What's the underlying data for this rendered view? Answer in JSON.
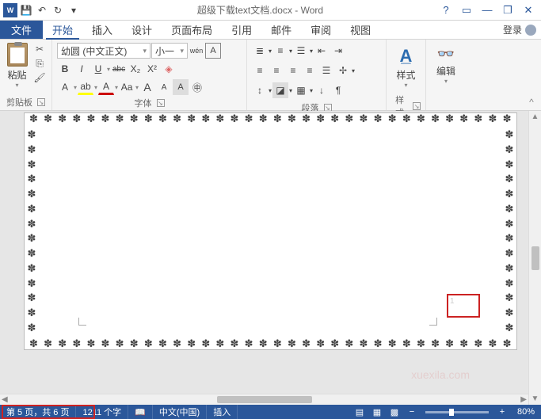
{
  "title": "超级下载text文档.docx - Word",
  "qat": {
    "save": "💾",
    "undo": "↶",
    "redo": "↻",
    "more": "▾"
  },
  "win": {
    "help": "?",
    "ribbonopts": "▭",
    "min": "—",
    "restore": "❐",
    "close": "✕"
  },
  "tabs": {
    "file": "文件",
    "home": "开始",
    "insert": "插入",
    "design": "设计",
    "layout": "页面布局",
    "references": "引用",
    "mailings": "邮件",
    "review": "审阅",
    "view": "视图",
    "signin": "登录"
  },
  "clipboard": {
    "paste": "粘贴",
    "group": "剪贴板"
  },
  "font": {
    "name": "幼圆 (中文正文)",
    "size": "小一",
    "wen": "wén",
    "Abox": "A",
    "group": "字体",
    "bold": "B",
    "italic": "I",
    "underline": "U",
    "strike": "abc",
    "sub": "X₂",
    "sup": "X²",
    "effects": "A",
    "highlight": "▁",
    "fontcolor": "A",
    "char": "Aa",
    "grow": "A",
    "shrink": "A",
    "change": "A",
    "clear": "◇"
  },
  "paragraph": {
    "group": "段落"
  },
  "styles": {
    "label": "样式",
    "group": "样式"
  },
  "editing": {
    "label": "编辑",
    "group": ""
  },
  "page": {
    "number": "1"
  },
  "status": {
    "page": "第 5 页，共 6 页",
    "words": "1211 个字",
    "proof": "📖",
    "lang": "中文(中国)",
    "insert": "插入",
    "zoom": "80%"
  },
  "watermark": "xuexila.com"
}
